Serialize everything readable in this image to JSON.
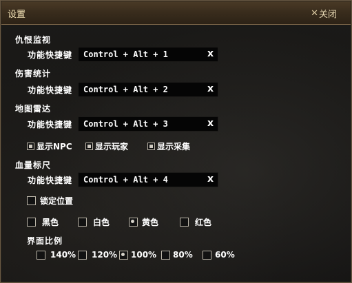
{
  "window": {
    "title": "设置",
    "close_label": "关闭",
    "close_icon": "close-icon"
  },
  "sections": {
    "hatred": {
      "label": "仇恨监视",
      "hotkey_label": "功能快捷键",
      "hotkey_value": "Control + Alt + 1",
      "clear": "x"
    },
    "damage": {
      "label": "伤害统计",
      "hotkey_label": "功能快捷键",
      "hotkey_value": "Control + Alt + 2",
      "clear": "x"
    },
    "radar": {
      "label": "地图雷达",
      "hotkey_label": "功能快捷键",
      "hotkey_value": "Control + Alt + 3",
      "clear": "x",
      "options": [
        {
          "label": "显示NPC",
          "checked": true
        },
        {
          "label": "显示玩家",
          "checked": true
        },
        {
          "label": "显示采集",
          "checked": true
        }
      ]
    },
    "hpbar": {
      "label": "血量标尺",
      "hotkey_label": "功能快捷键",
      "hotkey_value": "Control + Alt + 4",
      "clear": "x",
      "lock_label": "锁定位置",
      "lock_checked": false,
      "colors": [
        {
          "label": "黑色",
          "selected": false
        },
        {
          "label": "白色",
          "selected": false
        },
        {
          "label": "黄色",
          "selected": true
        },
        {
          "label": "红色",
          "selected": false
        }
      ],
      "scale_label": "界面比例",
      "scales": [
        {
          "label": "140%",
          "selected": false
        },
        {
          "label": "120%",
          "selected": false
        },
        {
          "label": "100%",
          "selected": true
        },
        {
          "label": "80%",
          "selected": false
        },
        {
          "label": "60%",
          "selected": false
        }
      ]
    }
  }
}
